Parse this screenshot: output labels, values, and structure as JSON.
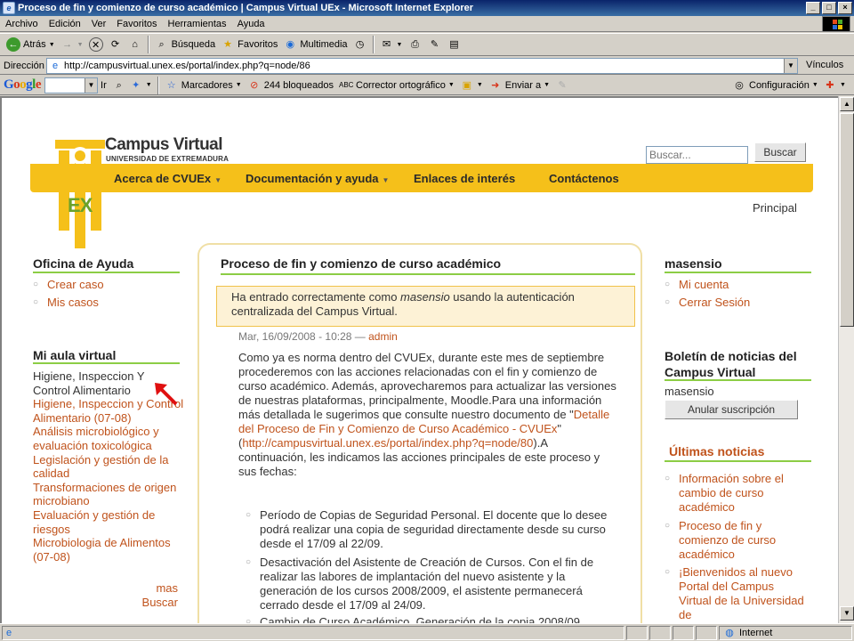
{
  "window": {
    "title": "Proceso de fin y comienzo de curso académico | Campus Virtual UEx - Microsoft Internet Explorer"
  },
  "menu": [
    "Archivo",
    "Edición",
    "Ver",
    "Favoritos",
    "Herramientas",
    "Ayuda"
  ],
  "toolbar": {
    "back": "Atrás",
    "search": "Búsqueda",
    "favorites": "Favoritos",
    "media": "Multimedia"
  },
  "address": {
    "label": "Dirección",
    "url": "http://campusvirtual.unex.es/portal/index.php?q=node/86",
    "links": "Vínculos"
  },
  "googlebar": {
    "logo": "Google",
    "go": "Ir",
    "bookmarks": "Marcadores",
    "blocked": "244 bloqueados",
    "spell": "Corrector ortográfico",
    "send": "Enviar a",
    "settings": "Configuración"
  },
  "site": {
    "brand_title": "Campus Virtual",
    "brand_sub": "UNIVERSIDAD DE EXTREMADURA",
    "logo_ex": "EX",
    "search_placeholder": "Buscar...",
    "search_button": "Buscar",
    "nav": [
      {
        "label": "Acerca de CVUEx",
        "caret": true
      },
      {
        "label": "Documentación y ayuda",
        "caret": true
      },
      {
        "label": "Enlaces de interés",
        "caret": false
      },
      {
        "label": "Contáctenos",
        "caret": false
      }
    ],
    "breadcrumb": "Principal"
  },
  "left": {
    "help_title": "Oficina de Ayuda",
    "help_links": [
      "Crear caso",
      "Mis casos"
    ],
    "classroom_title": "Mi aula virtual",
    "courses": [
      {
        "text": "Higiene, Inspeccion Y Control Alimentario",
        "link": false
      },
      {
        "text": "Higiene, Inspeccion y Control Alimentario (07-08)",
        "link": true
      },
      {
        "text": "Análisis microbiológico y evaluación toxicológica",
        "link": true
      },
      {
        "text": "Legislación y gestión de la calidad",
        "link": true
      },
      {
        "text": "Transformaciones de origen microbiano",
        "link": true
      },
      {
        "text": "Evaluación y gestión de riesgos",
        "link": true
      },
      {
        "text": "Microbiologia de Alimentos (07-08)",
        "link": true
      }
    ],
    "more": "mas",
    "search": "Buscar"
  },
  "main": {
    "title": "Proceso de fin y comienzo de curso académico",
    "notice_pre": "Ha entrado correctamente como ",
    "notice_user": "masensio",
    "notice_post": " usando la autenticación centralizada del Campus Virtual.",
    "meta_date": "Mar, 16/09/2008 - 10:28 — ",
    "meta_author": "admin",
    "body_pre": "Como ya es norma dentro del CVUEx, durante este mes de septiembre procederemos con las acciones relacionadas con el fin y comienzo de curso académico. Además, aprovecharemos para actualizar las versiones de nuestras plataformas, principalmente, Moodle.Para una información más detallada le sugerimos que consulte nuestro documento de \"",
    "body_link": "Detalle del Proceso de Fin y Comienzo de Curso Académico - CVUEx",
    "body_mid": "\" (",
    "body_url": "http://campusvirtual.unex.es/portal/index.php?q=node/80",
    "body_post": ").A continuación, les indicamos las acciones principales de este proceso y sus fechas:",
    "items": [
      "Período de Copias de Seguridad Personal. El docente que lo desee podrá realizar una copia de seguridad directamente desde su curso desde el 17/09 al 22/09.",
      "Desactivación del Asistente de Creación de Cursos. Con el fin de realizar las labores de implantación del nuevo asistente y la generación de los cursos 2008/2009, el asistente permanecerá cerrado desde el 17/09 al 24/09.",
      "Cambio de Curso Académico. Generación de la copia 2008/09"
    ]
  },
  "right": {
    "user_title": "masensio",
    "user_links": [
      "Mi cuenta",
      "Cerrar Sesión"
    ],
    "news_title": "Boletín de noticias del Campus Virtual",
    "news_user": "masensio",
    "unsubscribe": "Anular suscripción",
    "latest_title": "Últimas noticias",
    "latest": [
      "Información sobre el cambio de curso académico",
      "Proceso de fin y comienzo de curso académico",
      "¡Bienvenidos al nuevo Portal del Campus Virtual de la Universidad de"
    ]
  },
  "status": {
    "zone": "Internet"
  }
}
